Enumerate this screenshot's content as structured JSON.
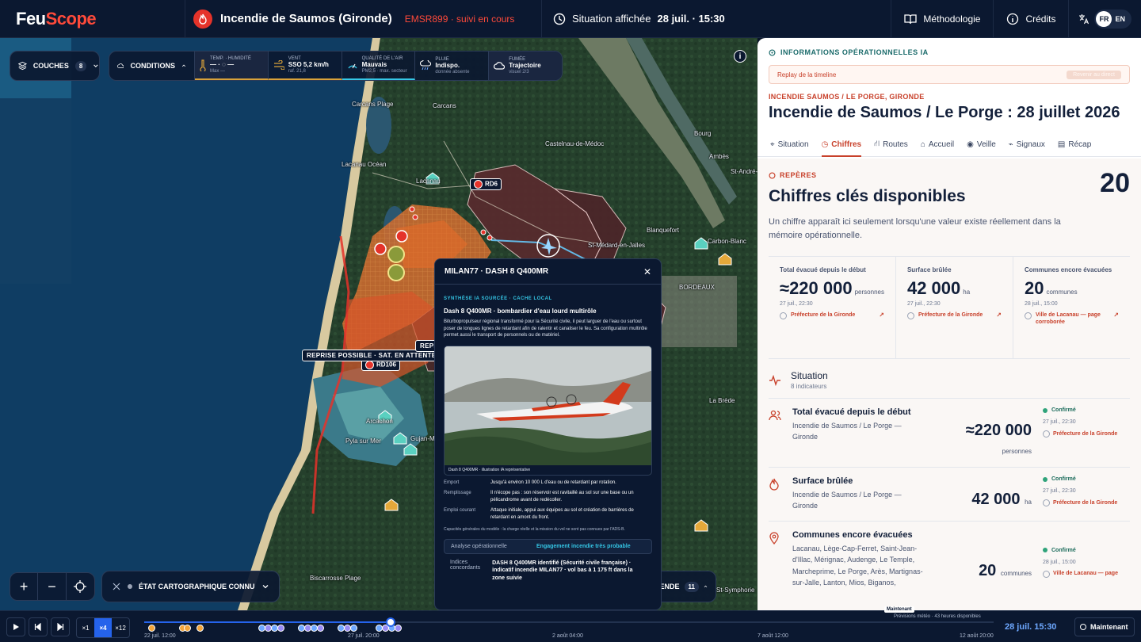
{
  "brand": {
    "part1": "Feu",
    "part2": "Scope"
  },
  "incident": {
    "title": "Incendie de Saumos (Gironde)",
    "code": "EMSR899 · suivi en cours"
  },
  "situation": {
    "prefix": "Situation affichée",
    "time": "28 juil. · 15:30"
  },
  "nav": {
    "methodology": "Méthodologie",
    "credits": "Crédits",
    "lang_active": "FR",
    "lang_other": "EN"
  },
  "map": {
    "layers_label": "COUCHES",
    "layers_count": "8",
    "conditions_label": "CONDITIONS",
    "conditions": [
      {
        "key": "TEMP. · HUMIDITÉ",
        "value": "— · ◌ —",
        "sub": "Max —",
        "icon": "thermometer-icon"
      },
      {
        "key": "VENT",
        "value": "SSO 5,2 km/h",
        "sub": "raf. 21,8",
        "icon": "wind-icon"
      },
      {
        "key": "QUALITÉ DE L'AIR",
        "value": "Mauvais",
        "sub": "PM2,5 · max. secteur",
        "icon": "air-quality-icon"
      },
      {
        "key": "PLUIE",
        "value": "Indispo.",
        "sub": "donnée absente",
        "icon": "rain-icon"
      },
      {
        "key": "FUMÉE",
        "value": "Trajectoire",
        "sub": "visuel 2/3",
        "icon": "smoke-icon"
      }
    ],
    "places": [
      {
        "name": "Carcans Plage"
      },
      {
        "name": "Carcans"
      },
      {
        "name": "Castelnau-de-Médoc"
      },
      {
        "name": "Lacanau Océan"
      },
      {
        "name": "Lacanau"
      },
      {
        "name": "Bourg"
      },
      {
        "name": "Ambès"
      },
      {
        "name": "St-André-"
      },
      {
        "name": "Blanquefort"
      },
      {
        "name": "St-Médard-en-Jalles"
      },
      {
        "name": "Carbon-Blanc"
      },
      {
        "name": "BORDEAUX"
      },
      {
        "name": "La Brède"
      },
      {
        "name": "Arcachon"
      },
      {
        "name": "Pyla sur Mer"
      },
      {
        "name": "Gujan-M"
      },
      {
        "name": "Biscarrosse Plage"
      },
      {
        "name": "St-Symphorie"
      }
    ],
    "roads": {
      "rd6": "RD6",
      "rd106": "RD106"
    },
    "alert_tag": "REPRISE POSSIBLE · SAT. EN ATTENTE",
    "alert_tag2": "REPR",
    "state_label": "ÉTAT CARTOGRAPHIQUE CONNU",
    "legend_label": "LÉGENDE",
    "legend_count": "11",
    "zoom_in": "+",
    "zoom_out": "−"
  },
  "popup": {
    "title": "MILAN77 · DASH 8 Q400MR",
    "section": "SYNTHÈSE IA SOURCÉE · CACHE LOCAL",
    "aircraft_title": "Dash 8 Q400MR · bombardier d'eau lourd multirôle",
    "description": "Biturbopropulseur régional transformé pour la Sécurité civile, il peut larguer de l'eau ou surtout poser de longues lignes de retardant afin de ralentir et canaliser le feu. Sa configuration multirôle permet aussi le transport de personnels ou de matériel.",
    "photo_caption": "Dash 8 Q400MR · illustration IA représentative",
    "specs": [
      {
        "k": "Emport",
        "v": "Jusqu'à environ 10 000 L d'eau ou de retardant par rotation."
      },
      {
        "k": "Remplissage",
        "v": "Il n'écope pas : son réservoir est ravitaillé au sol sur une base ou un pélicandrome avant de redécoller."
      },
      {
        "k": "Emploi courant",
        "v": "Attaque initiale, appui aux équipes au sol et création de barrières de retardant en amont du front."
      }
    ],
    "note": "Capacités générales du modèle : la charge réelle et la mission du vol ne sont pas connues par l'ADS-B.",
    "analysis_k": "Analyse opérationnelle",
    "analysis_v": "Engagement incendie très probable",
    "indices_k": "Indices concordants",
    "indices_v": "DASH 8 Q400MR identifié (Sécurité civile française) · indicatif incendie MILAN77 · vol bas à 1 175 ft dans la zone suivie"
  },
  "panel": {
    "ia_label": "INFORMATIONS OPÉRATIONNELLES IA",
    "replay_label": "Replay de la timeline",
    "replay_btn": "Revenir au direct",
    "kicker": "INCENDIE SAUMOS / LE PORGE, GIRONDE",
    "title": "Incendie de Saumos / Le Porge : 28 juillet 2026",
    "tabs": [
      {
        "label": "Situation",
        "icon": "compass-icon"
      },
      {
        "label": "Chiffres",
        "icon": "gauge-icon"
      },
      {
        "label": "Routes",
        "icon": "road-icon"
      },
      {
        "label": "Accueil",
        "icon": "home-icon"
      },
      {
        "label": "Veille",
        "icon": "radio-icon"
      },
      {
        "label": "Signaux",
        "icon": "signal-icon"
      },
      {
        "label": "Récap",
        "icon": "document-icon"
      }
    ],
    "reperes_label": "REPÈRES",
    "reperes_count": "20",
    "reperes_title": "Chiffres clés disponibles",
    "reperes_desc": "Un chiffre apparaît ici seulement lorsqu'une valeur existe réellement dans la mémoire opérationnelle.",
    "kpis": [
      {
        "label": "Total évacué depuis le début",
        "value": "≈220 000",
        "unit": "personnes",
        "date": "27 juil., 22:30",
        "source": "Préfecture de la Gironde"
      },
      {
        "label": "Surface brûlée",
        "value": "42 000",
        "unit": "ha",
        "date": "27 juil., 22:30",
        "source": "Préfecture de la Gironde"
      },
      {
        "label": "Communes encore évacuées",
        "value": "20",
        "unit": "communes",
        "date": "28 juil., 15:00",
        "source": "Ville de Lacanau — page corroborée"
      }
    ],
    "situation_title": "Situation",
    "situation_sub": "8 indicateurs",
    "rows": [
      {
        "title": "Total évacué depuis le début",
        "sub": "Incendie de Saumos / Le Porge — Gironde",
        "value": "≈220 000",
        "unit": "personnes",
        "status": "Confirmé",
        "date": "27 juil., 22:30",
        "source": "Préfecture de la Gironde"
      },
      {
        "title": "Surface brûlée",
        "sub": "Incendie de Saumos / Le Porge — Gironde",
        "value": "42 000",
        "unit": "ha",
        "status": "Confirmé",
        "date": "27 juil., 22:30",
        "source": "Préfecture de la Gironde"
      },
      {
        "title": "Communes encore évacuées",
        "sub": "Lacanau, Lège-Cap-Ferret, Saint-Jean-d'Illac, Mérignac, Audenge, Le Temple, Marcheprime, Le Porge, Arès, Martignas-sur-Jalle, Lanton, Mios, Biganos, Salaunes, Saumos…",
        "value": "20",
        "unit": "communes",
        "status": "Confirmé",
        "date": "28 juil., 15:00",
        "source": "Ville de Lacanau — page"
      }
    ]
  },
  "timeline": {
    "speeds": [
      "×1",
      "×4",
      "×12"
    ],
    "progress": 0.29,
    "labels": [
      "22 juil. 12:00",
      "27 juil. 20:00",
      "2 août 04:00",
      "7 août 12:00",
      "12 août 20:00"
    ],
    "now_tag": "Maintenant",
    "forecast": "Prévisions météo · 43 heures disponibles",
    "current_time": "28 juil. 15:30",
    "now_button": "Maintenant"
  },
  "colors": {
    "accent": "#c8412b",
    "brand_red": "#ff4a3a",
    "navy": "#0b1830",
    "teal": "#35c7e6",
    "blue": "#2563eb"
  }
}
